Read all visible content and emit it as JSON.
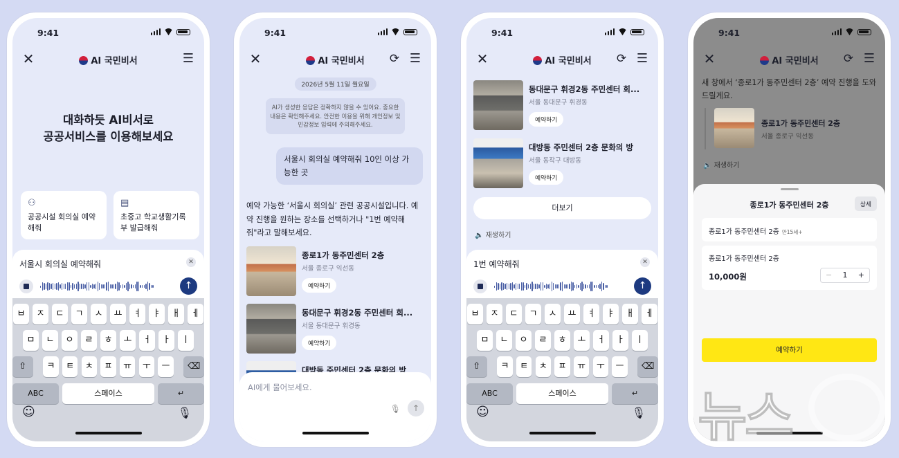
{
  "status": {
    "time": "9:41"
  },
  "app": {
    "title": "AI 국민비서"
  },
  "screen1": {
    "hero_line1": "대화하듯 AI비서로",
    "hero_line2": "공공서비스를 이용해보세요",
    "suggestions": [
      {
        "label": "공공시설 회의실 예약해줘",
        "icon": "people-icon"
      },
      {
        "label": "초중고 학교생활기록부 발급해줘",
        "icon": "document-icon"
      }
    ],
    "input_text": "서울시 회의실 예약해줘"
  },
  "keyboard": {
    "row1": [
      "ㅂ",
      "ㅈ",
      "ㄷ",
      "ㄱ",
      "ㅅ",
      "ㅛ",
      "ㅕ",
      "ㅑ",
      "ㅐ",
      "ㅔ"
    ],
    "row2": [
      "ㅁ",
      "ㄴ",
      "ㅇ",
      "ㄹ",
      "ㅎ",
      "ㅗ",
      "ㅓ",
      "ㅏ",
      "ㅣ"
    ],
    "row3": [
      "ㅋ",
      "ㅌ",
      "ㅊ",
      "ㅍ",
      "ㅠ",
      "ㅜ",
      "ㅡ"
    ],
    "abc": "ABC",
    "space": "스페이스"
  },
  "screen2": {
    "date": "2026년 5월 11일 월요일",
    "notice": "AI가 생성한 응답은 정확하지 않을 수 있어요. 중요한 내용은 확인해주세요. 안전한 이용을 위해 개인정보 및 민감정보 입력에 주의해주세요.",
    "user_message": "서울시 회의실 예약해줘 10인 이상 가능한 곳",
    "answer": "예약 가능한 ‘서울시 회의실’ 관련 공공시설입니다. 예약 진행을 원하는 장소를 선택하거나 \"1번 예약해 줘\"라고 말해보세요.",
    "ask_placeholder": "AI에게 물어보세요."
  },
  "results": [
    {
      "title": "종로1가 동주민센터 2층",
      "location": "서울 종로구 익선동",
      "button": "예약하기"
    },
    {
      "title": "동대문구 휘경2동 주민센터 회...",
      "location": "서울 동대문구 휘경동",
      "button": "예약하기"
    },
    {
      "title": "대방동 주민센터 2층 문화의 방",
      "location": "서울 동작구 대방동",
      "button": "예약하기"
    }
  ],
  "screen3": {
    "more": "더보기",
    "replay": "재생하기",
    "input_text": "1번 예약해줘"
  },
  "screen4": {
    "intro": "새 창에서 ‘종로1가 동주민센터 2층’ 예약 진행을 도와드릴게요.",
    "mini_title": "종로1가 동주민센터 2층",
    "mini_location": "서울 종로구 익선동",
    "replay": "재생하기",
    "sheet_title": "종로1가 동주민센터 2층",
    "detail": "상세",
    "option_name": "종로1가 동주민센터 2층",
    "option_capacity": "만15세+",
    "option2_name": "종로1가 동주민센터 2층",
    "price": "10,000원",
    "quantity": "1",
    "reserve": "예약하기"
  },
  "watermark": "뉴스1"
}
